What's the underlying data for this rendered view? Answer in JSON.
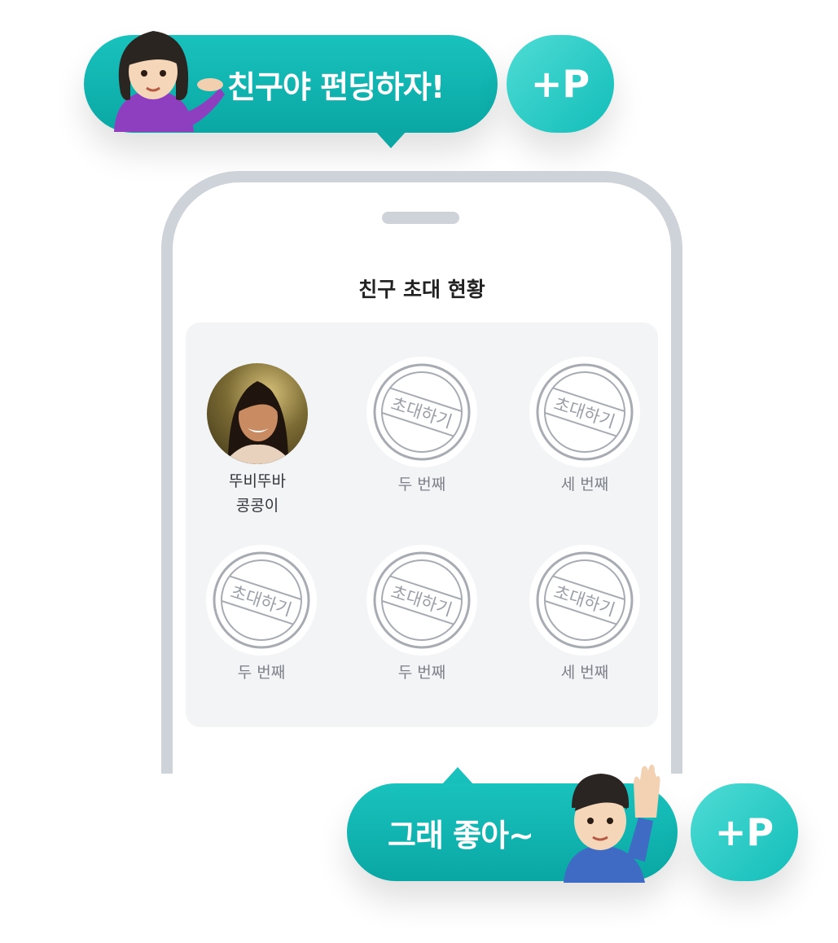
{
  "bubbles": {
    "top": {
      "text": "친구야 펀딩하자!",
      "plus": "+P"
    },
    "bottom": {
      "text": "그래 좋아~",
      "plus": "+P"
    }
  },
  "screen": {
    "title": "친구 초대 현황",
    "stamp_text": "초대하기",
    "slots": [
      {
        "type": "friend",
        "label_line1": "뚜비뚜바",
        "label_line2": "콩콩이"
      },
      {
        "type": "empty",
        "label": "두 번째"
      },
      {
        "type": "empty",
        "label": "세 번째"
      },
      {
        "type": "empty",
        "label": "두 번째"
      },
      {
        "type": "empty",
        "label": "두 번째"
      },
      {
        "type": "empty",
        "label": "세 번째"
      }
    ]
  },
  "colors": {
    "bubble": "#12b5b2",
    "plus": "#2fd0ca",
    "phone_frame": "#ced3da",
    "panel": "#f3f4f6"
  },
  "icons": [
    "woman-tipping-hand-emoji",
    "man-raising-hand-emoji",
    "invite-stamp-icon"
  ]
}
